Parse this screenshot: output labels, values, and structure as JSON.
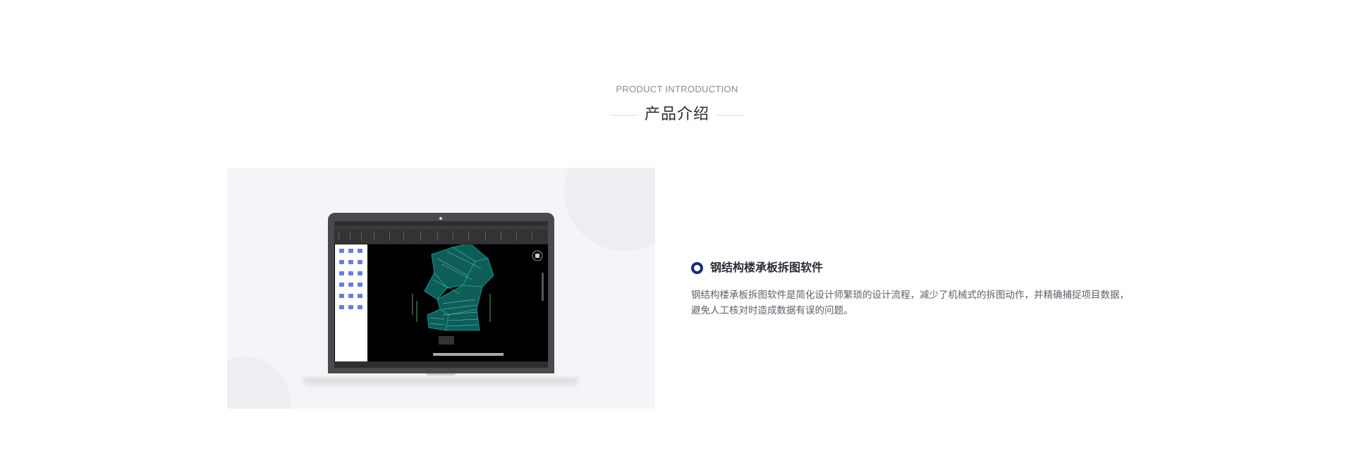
{
  "section": {
    "eyebrow": "PRODUCT INTRODUCTION",
    "title": "产品介绍"
  },
  "product": {
    "name": "钢结构楼承板拆图软件",
    "description": "钢结构楼承板拆图软件是简化设计师繁琐的设计流程，减少了机械式的拆图动作，并精确捕捉项目数据，避免人工核对时造成数据有误的问题。",
    "image_icon": "laptop-cad-screenshot"
  },
  "colors": {
    "accent": "#1b2a78",
    "panel_bg": "#f3f5f9",
    "cad_teal": "#1fa9a0"
  }
}
